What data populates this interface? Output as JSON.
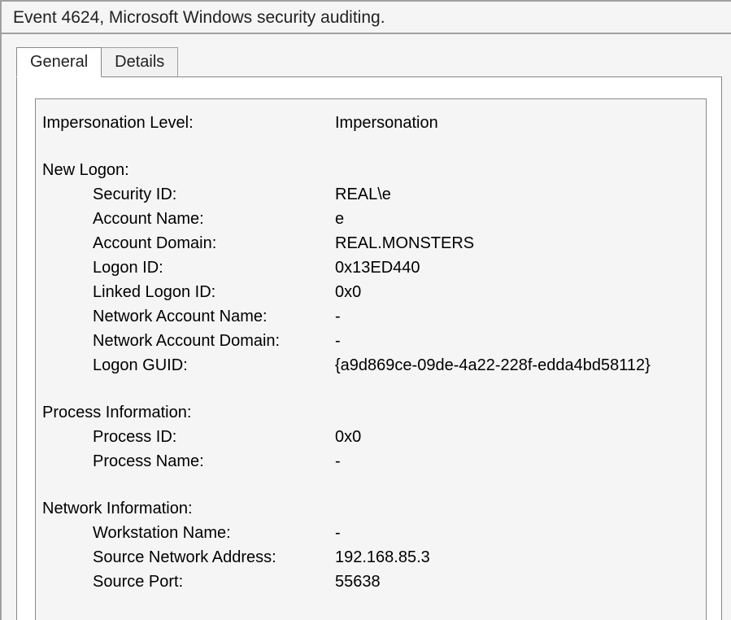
{
  "window": {
    "title": "Event 4624, Microsoft Windows security auditing."
  },
  "tabs": {
    "general": "General",
    "details": "Details"
  },
  "event": {
    "impersonation": {
      "label": "Impersonation Level:",
      "value": "Impersonation"
    },
    "newLogon": {
      "heading": "New Logon:",
      "securityId": {
        "label": "Security ID:",
        "value": "REAL\\e"
      },
      "accountName": {
        "label": "Account Name:",
        "value": "e"
      },
      "accountDomain": {
        "label": "Account Domain:",
        "value": "REAL.MONSTERS"
      },
      "logonId": {
        "label": "Logon ID:",
        "value": "0x13ED440"
      },
      "linkedLogonId": {
        "label": "Linked Logon ID:",
        "value": "0x0"
      },
      "netAcctName": {
        "label": "Network Account Name:",
        "value": "-"
      },
      "netAcctDomain": {
        "label": "Network Account Domain:",
        "value": "-"
      },
      "logonGuid": {
        "label": "Logon GUID:",
        "value": "{a9d869ce-09de-4a22-228f-edda4bd58112}"
      }
    },
    "processInfo": {
      "heading": "Process Information:",
      "processId": {
        "label": "Process ID:",
        "value": "0x0"
      },
      "processName": {
        "label": "Process Name:",
        "value": "-"
      }
    },
    "networkInfo": {
      "heading": "Network Information:",
      "workstation": {
        "label": "Workstation Name:",
        "value": "-"
      },
      "sourceAddr": {
        "label": "Source Network Address:",
        "value": "192.168.85.3"
      },
      "sourcePort": {
        "label": "Source Port:",
        "value": "55638"
      }
    }
  }
}
